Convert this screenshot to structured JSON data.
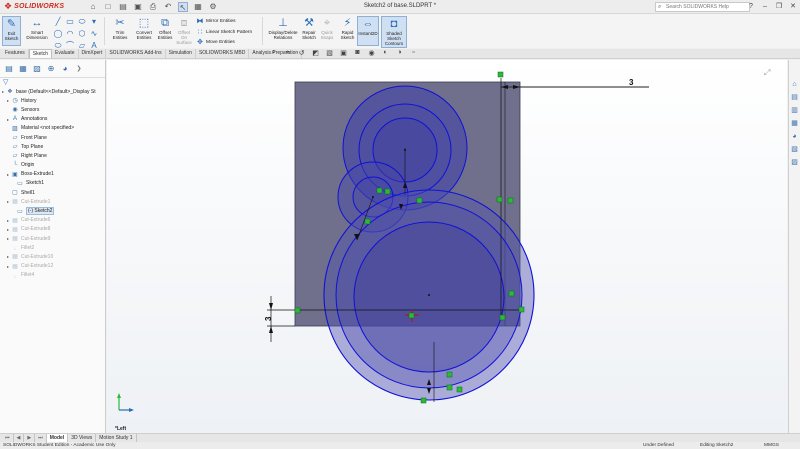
{
  "app": {
    "brand": "SOLIDWORKS",
    "document_title": "Sketch2 of base.SLDPRT *"
  },
  "search": {
    "placeholder": "Search SOLIDWORKS Help"
  },
  "ribbon": {
    "exit_sketch": "Exit Sketch",
    "smart_dimension": "Smart Dimension",
    "trim_entities": "Trim Entities",
    "convert_entities": "Convert Entities",
    "offset_entities": "Offset Entities",
    "offset_on_surface": "Offset On Surface",
    "mirror_entities": "Mirror Entities",
    "linear_sketch_pattern": "Linear Sketch Pattern",
    "move_entities": "Move Entities",
    "display_delete_relations": "Display/Delete Relations",
    "repair_sketch": "Repair Sketch",
    "quick_snaps": "Quick Snaps",
    "rapid_sketch": "Rapid Sketch",
    "instant2d": "Instant2D",
    "shaded_sketch_contours": "Shaded Sketch Contours"
  },
  "tabs": [
    "Features",
    "Sketch",
    "Evaluate",
    "DimXpert",
    "SOLIDWORKS Add-Ins",
    "Simulation",
    "SOLIDWORKS MBD",
    "Analysis Preparation"
  ],
  "tree": [
    {
      "label": "base  (Default<<Default>_Display St",
      "icon": "part-icon",
      "state": "normal"
    },
    {
      "label": "History",
      "icon": "history-icon",
      "state": "normal"
    },
    {
      "label": "Sensors",
      "icon": "sensor-icon",
      "state": "normal"
    },
    {
      "label": "Annotations",
      "icon": "annotation-icon",
      "state": "normal"
    },
    {
      "label": "Material <not specified>",
      "icon": "material-icon",
      "state": "normal"
    },
    {
      "label": "Front Plane",
      "icon": "plane-icon",
      "state": "normal"
    },
    {
      "label": "Top Plane",
      "icon": "plane-icon",
      "state": "normal"
    },
    {
      "label": "Right Plane",
      "icon": "plane-icon",
      "state": "normal"
    },
    {
      "label": "Origin",
      "icon": "origin-icon",
      "state": "normal"
    },
    {
      "label": "Boss-Extrude1",
      "icon": "extrude-icon",
      "state": "normal"
    },
    {
      "label": "Sketch1",
      "icon": "sketch-icon",
      "state": "normal"
    },
    {
      "label": "Shell1",
      "icon": "shell-icon",
      "state": "normal"
    },
    {
      "label": "Cut-Extrude1",
      "icon": "cut-icon",
      "state": "suppressed"
    },
    {
      "label": "(-) Sketch2",
      "icon": "sketch-icon",
      "state": "selected"
    },
    {
      "label": "Cut-Extrude6",
      "icon": "cut-icon",
      "state": "suppressed"
    },
    {
      "label": "Cut-Extrude8",
      "icon": "cut-icon",
      "state": "suppressed"
    },
    {
      "label": "Cut-Extrude9",
      "icon": "cut-icon",
      "state": "suppressed"
    },
    {
      "label": "Fillet2",
      "icon": "fillet-icon",
      "state": "suppressed"
    },
    {
      "label": "Cut-Extrude10",
      "icon": "cut-icon",
      "state": "suppressed"
    },
    {
      "label": "Cut-Extrude12",
      "icon": "cut-icon",
      "state": "suppressed"
    },
    {
      "label": "Fillet4",
      "icon": "fillet-icon",
      "state": "suppressed"
    }
  ],
  "dimensions": {
    "horizontal": "3",
    "vertical": "3"
  },
  "view": {
    "name": "*Left"
  },
  "bottom_tabs": [
    "Model",
    "3D Views",
    "Motion Study 1"
  ],
  "status": {
    "edition": "SOLIDWORKS Student Edition - Academic Use Only",
    "definition": "Under Defined",
    "editing": "Editing Sketch2",
    "units": "MMGS"
  },
  "colors": {
    "accent": "#2a6cb8",
    "brand": "#d12a1d",
    "sketch": "#1a1ad0",
    "face": "#6c6c8c"
  }
}
